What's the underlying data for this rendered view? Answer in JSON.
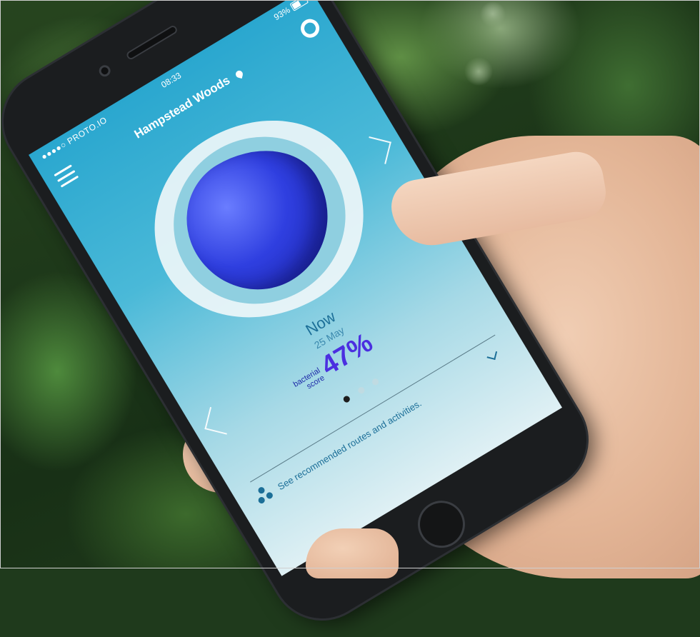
{
  "status_bar": {
    "carrier": "●●●●○ PROTO.IO",
    "time": "08:33",
    "battery": "93%"
  },
  "header": {
    "location": "Hampstead Woods"
  },
  "reading": {
    "when": "Now",
    "date": "25 May",
    "score_label": "bacterial score",
    "score_value": "47%"
  },
  "pager": {
    "count": 3,
    "active_index": 0
  },
  "footer": {
    "cta": "See recommended routes and activities."
  },
  "colors": {
    "screen_top": "#2aa7cf",
    "score": "#4b2fe0",
    "microbe": "#2f3fe0"
  },
  "icons": [
    "menu-icon",
    "location-pin-icon",
    "ring-icon",
    "chevron-left-icon",
    "chevron-right-icon",
    "dots-cluster-icon",
    "chevron-down-icon"
  ]
}
